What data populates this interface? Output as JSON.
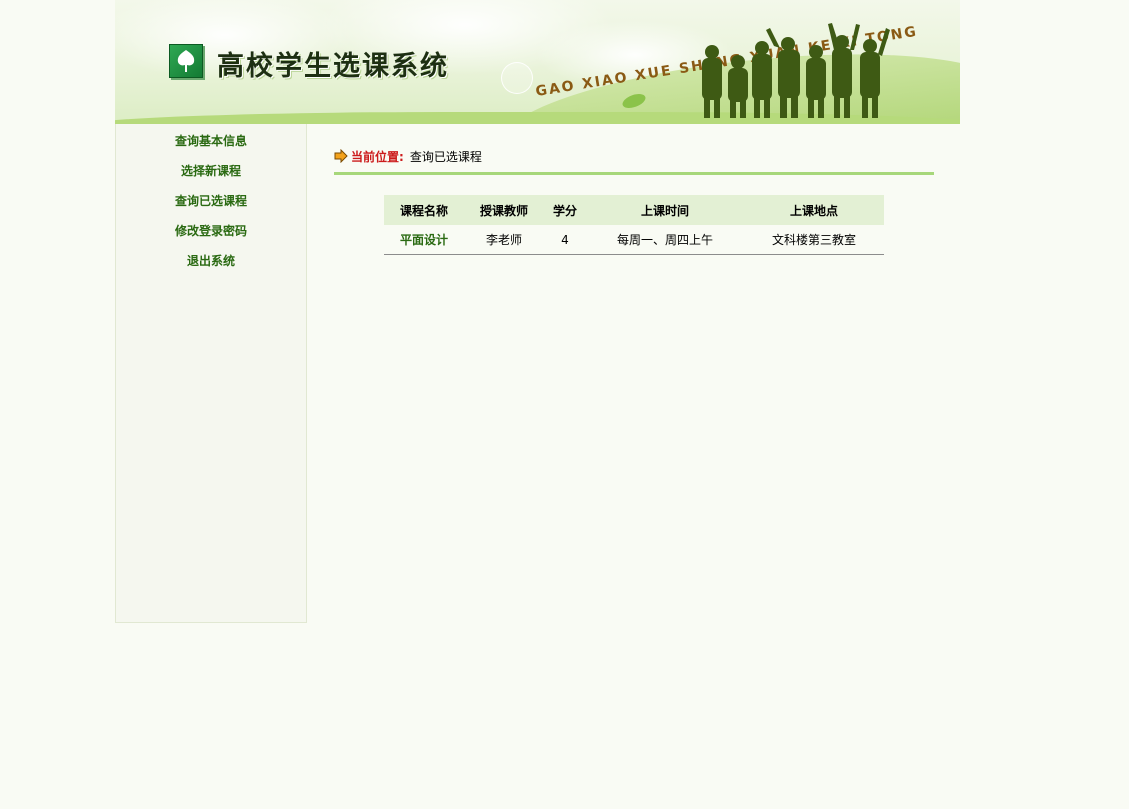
{
  "header": {
    "system_title": "高校学生选课系统",
    "pinyin": "GAO XIAO XUE SHENG XUAN KE XI TONG"
  },
  "sidebar": {
    "items": [
      {
        "label": "查询基本信息"
      },
      {
        "label": "选择新课程"
      },
      {
        "label": "查询已选课程"
      },
      {
        "label": "修改登录密码"
      },
      {
        "label": "退出系统"
      }
    ]
  },
  "location": {
    "label": "当前位置:",
    "value": "查询已选课程"
  },
  "table": {
    "headers": [
      "课程名称",
      "授课教师",
      "学分",
      "上课时间",
      "上课地点"
    ],
    "rows": [
      {
        "name": "平面设计",
        "teacher": "李老师",
        "credit": "4",
        "time": "每周一、周四上午",
        "place": "文科楼第三教室"
      }
    ]
  },
  "colors": {
    "accent_green": "#2a6a12",
    "location_red": "#cc1b1b",
    "divider_green": "#a7d77a",
    "table_header_bg": "#e3f0d4"
  }
}
